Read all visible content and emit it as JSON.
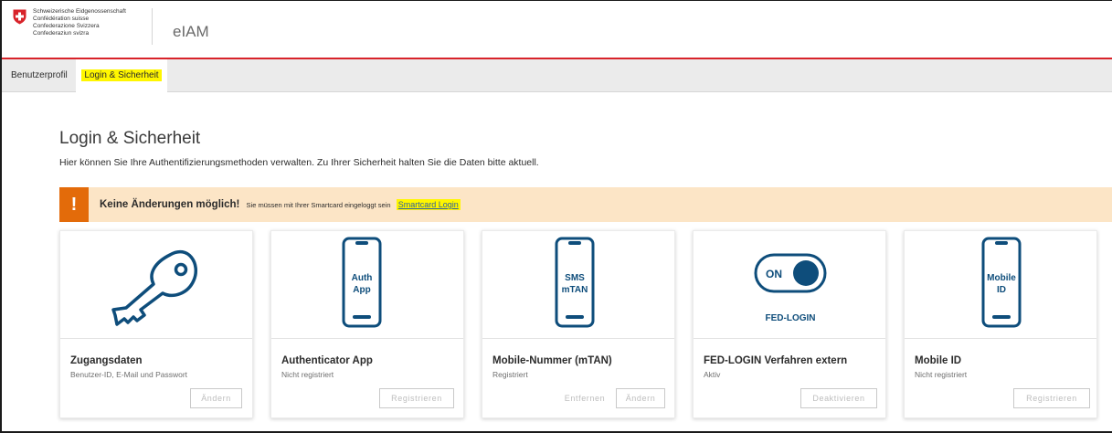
{
  "header": {
    "confederation_lines": [
      "Schweizerische Eidgenossenschaft",
      "Confédération suisse",
      "Confederazione Svizzera",
      "Confederaziun svizra"
    ],
    "app_name": "eIAM"
  },
  "tabs": [
    {
      "label": "Benutzerprofil",
      "active": false
    },
    {
      "label": "Login & Sicherheit",
      "active": true
    }
  ],
  "page": {
    "title": "Login & Sicherheit",
    "subtitle": "Hier können Sie Ihre Authentifizierungsmethoden verwalten. Zu Ihrer Sicherheit halten Sie die Daten bitte aktuell."
  },
  "alert": {
    "icon": "!",
    "strong": "Keine Änderungen möglich!",
    "text": "Sie müssen mit Ihrer Smartcard eingeloggt sein",
    "link": "Smartcard Login"
  },
  "cards": [
    {
      "title": "Zugangsdaten",
      "status": "Benutzer-ID, E-Mail und Passwort",
      "visual": "key-icon",
      "buttons": [
        "Ändern"
      ]
    },
    {
      "title": "Authenticator App",
      "status": "Nicht registriert",
      "visual": "phone-icon",
      "phone_text": [
        "Auth",
        "App"
      ],
      "buttons": [
        "Registrieren"
      ]
    },
    {
      "title": "Mobile-Nummer (mTAN)",
      "status": "Registriert",
      "visual": "phone-icon",
      "phone_text": [
        "SMS",
        "mTAN"
      ],
      "buttons": [
        "Entfernen",
        "Ändern"
      ]
    },
    {
      "title": "FED-LOGIN Verfahren extern",
      "status": "Aktiv",
      "visual": "toggle-icon",
      "toggle_text": "ON",
      "visual_label": "FED-LOGIN",
      "buttons": [
        "Deaktivieren"
      ]
    },
    {
      "title": "Mobile ID",
      "status": "Nicht registriert",
      "visual": "phone-icon",
      "phone_text": [
        "Mobile",
        "ID"
      ],
      "buttons": [
        "Registrieren"
      ]
    }
  ],
  "colors": {
    "accent_red": "#d8232a",
    "icon_blue": "#0e4d7b",
    "alert_bg": "#fce5c6",
    "alert_icon_bg": "#e36b0a",
    "highlight": "#fff600"
  }
}
